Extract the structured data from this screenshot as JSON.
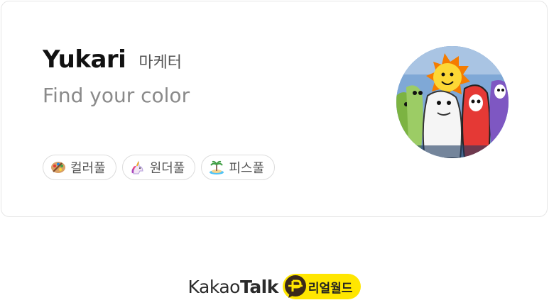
{
  "profile": {
    "name": "Yukari",
    "role": "마케터",
    "tagline": "Find your color"
  },
  "chips": [
    {
      "label": "컬러풀",
      "icon": "palette-icon"
    },
    {
      "label": "원더풀",
      "icon": "unicorn-icon"
    },
    {
      "label": "피스풀",
      "icon": "island-icon"
    }
  ],
  "footer": {
    "brand_light": "Kakao",
    "brand_bold": "Talk",
    "badge_label": "리얼월드",
    "badge_icon": "p-speech-bubble-icon"
  },
  "colors": {
    "accent_yellow": "#ffe600",
    "card_border": "#e6e6e6",
    "text_muted": "#8a8a8a"
  }
}
